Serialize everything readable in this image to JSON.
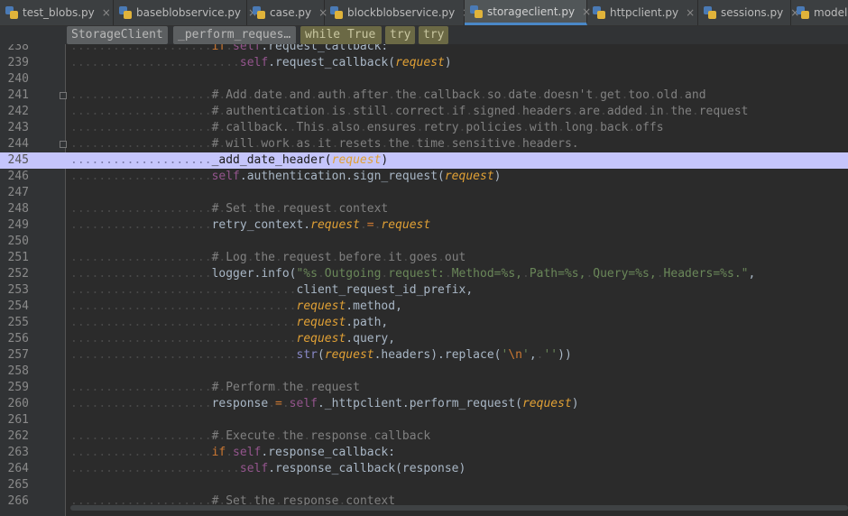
{
  "tabs": [
    {
      "label": "test_blobs.py",
      "active": false
    },
    {
      "label": "baseblobservice.py",
      "active": false
    },
    {
      "label": "case.py",
      "active": false
    },
    {
      "label": "blockblobservice.py",
      "active": false
    },
    {
      "label": "storageclient.py",
      "active": true
    },
    {
      "label": "httpclient.py",
      "active": false
    },
    {
      "label": "sessions.py",
      "active": false
    },
    {
      "label": "models",
      "active": false
    }
  ],
  "tab_close_glyph": "×",
  "breadcrumb": [
    "StorageClient",
    "_perform_reques…",
    "while True",
    "try",
    "try"
  ],
  "current_line": "245",
  "lines": [
    {
      "n": "238",
      "indent": 20,
      "text": "if self.request_callback:"
    },
    {
      "n": "239",
      "indent": 24,
      "text": "self.request_callback(request)"
    },
    {
      "n": "240",
      "indent": 0,
      "text": ""
    },
    {
      "n": "241",
      "indent": 20,
      "text": "# Add date and auth after the callback so date doesn't get too old and"
    },
    {
      "n": "242",
      "indent": 20,
      "text": "# authentication is still correct if signed headers are added in the request"
    },
    {
      "n": "243",
      "indent": 20,
      "text": "# callback. This also ensures retry policies with long back offs"
    },
    {
      "n": "244",
      "indent": 20,
      "text": "# will work as it resets the time sensitive headers."
    },
    {
      "n": "245",
      "indent": 20,
      "text": "_add_date_header(request)"
    },
    {
      "n": "246",
      "indent": 20,
      "text": "self.authentication.sign_request(request)"
    },
    {
      "n": "247",
      "indent": 0,
      "text": ""
    },
    {
      "n": "248",
      "indent": 20,
      "text": "# Set the request context"
    },
    {
      "n": "249",
      "indent": 20,
      "text": "retry_context.request = request"
    },
    {
      "n": "250",
      "indent": 0,
      "text": ""
    },
    {
      "n": "251",
      "indent": 20,
      "text": "# Log the request before it goes out"
    },
    {
      "n": "252",
      "indent": 20,
      "text": "logger.info(\"%s Outgoing request: Method=%s, Path=%s, Query=%s, Headers=%s.\","
    },
    {
      "n": "253",
      "indent": 32,
      "text": "client_request_id_prefix,"
    },
    {
      "n": "254",
      "indent": 32,
      "text": "request.method,"
    },
    {
      "n": "255",
      "indent": 32,
      "text": "request.path,"
    },
    {
      "n": "256",
      "indent": 32,
      "text": "request.query,"
    },
    {
      "n": "257",
      "indent": 32,
      "text": "str(request.headers).replace('\\n', ''))"
    },
    {
      "n": "258",
      "indent": 0,
      "text": ""
    },
    {
      "n": "259",
      "indent": 20,
      "text": "# Perform the request"
    },
    {
      "n": "260",
      "indent": 20,
      "text": "response = self._httpclient.perform_request(request)"
    },
    {
      "n": "261",
      "indent": 0,
      "text": ""
    },
    {
      "n": "262",
      "indent": 20,
      "text": "# Execute the response callback"
    },
    {
      "n": "263",
      "indent": 20,
      "text": "if self.response_callback:"
    },
    {
      "n": "264",
      "indent": 24,
      "text": "self.response_callback(response)"
    },
    {
      "n": "265",
      "indent": 0,
      "text": ""
    },
    {
      "n": "266",
      "indent": 20,
      "text": "# Set the response context"
    }
  ],
  "colors": {
    "background": "#2b2b2b",
    "current_line": "#c5c5fb",
    "comment": "#808080",
    "string": "#6a8759",
    "keyword": "#cc7832",
    "self": "#94558d",
    "param": "#aa4926",
    "active_tab_underline": "#4a88c7"
  }
}
